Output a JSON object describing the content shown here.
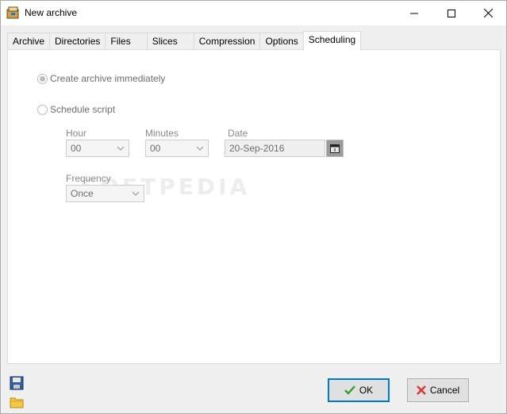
{
  "window": {
    "title": "New archive",
    "icon": "archive-app-icon",
    "controls": [
      "minimize",
      "maximize",
      "close"
    ]
  },
  "tabs": [
    {
      "label": "Archive",
      "active": false
    },
    {
      "label": "Directories",
      "active": false
    },
    {
      "label": "Files",
      "active": false
    },
    {
      "label": "Slices",
      "active": false
    },
    {
      "label": "Compression",
      "active": false
    },
    {
      "label": "Options",
      "active": false
    },
    {
      "label": "Scheduling",
      "active": true
    }
  ],
  "scheduling": {
    "create_immediately_label": "Create archive immediately",
    "create_immediately_selected": true,
    "schedule_script_label": "Schedule script",
    "schedule_script_selected": false,
    "hour_label": "Hour",
    "hour_value": "00",
    "minutes_label": "Minutes",
    "minutes_value": "00",
    "date_label": "Date",
    "date_value": "20-Sep-2016",
    "frequency_label": "Frequency",
    "frequency_value": "Once"
  },
  "watermark": "SOFTPEDIA",
  "footer": {
    "ok_label": "OK",
    "cancel_label": "Cancel",
    "save_icon": "floppy-disk-icon",
    "open_icon": "folder-icon"
  },
  "colors": {
    "accent": "#0078d7",
    "ok_check": "#2e9e2e",
    "cancel_x": "#d9342b"
  }
}
